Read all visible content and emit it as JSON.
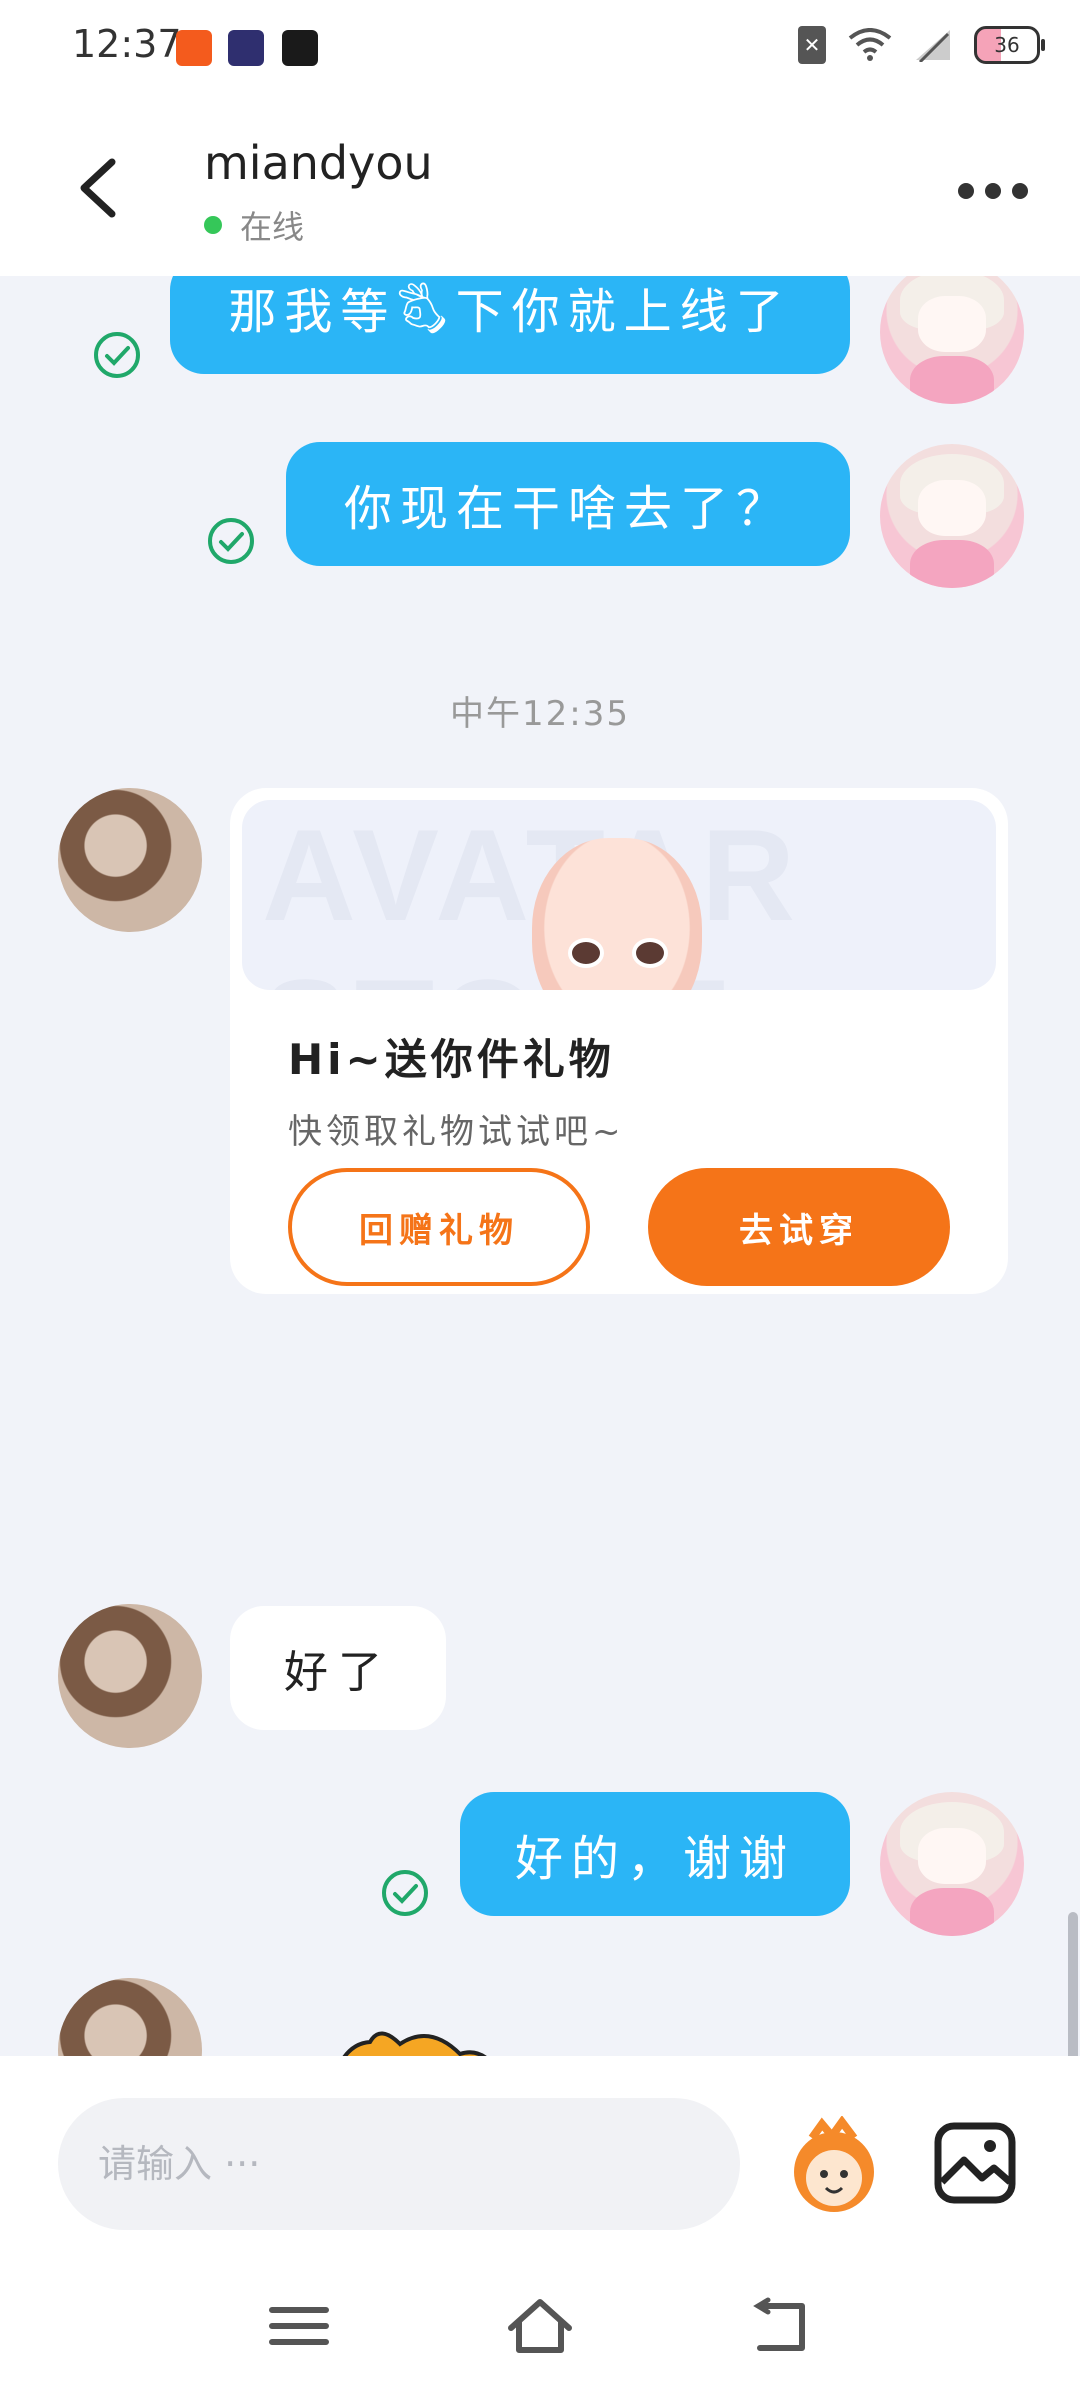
{
  "status_bar": {
    "time": "12:37",
    "battery": "36"
  },
  "header": {
    "contact_name": "miandyou",
    "status": "在线"
  },
  "messages": [
    {
      "side": "right",
      "type": "text",
      "text": "那我等🖏下你就上线了"
    },
    {
      "side": "right",
      "type": "text",
      "text": "你现在干啥去了？"
    },
    {
      "type": "timestamp",
      "text": "中午12:35"
    },
    {
      "side": "left",
      "type": "gift_card",
      "banner_watermark": "AVATAR STORE",
      "title": "Hi~送你件礼物",
      "subtitle": "快领取礼物试试吧~",
      "button_return": "回赠礼物",
      "button_try": "去试穿"
    },
    {
      "side": "left",
      "type": "text",
      "text": "好了"
    },
    {
      "side": "right",
      "type": "text",
      "text": "好的，谢谢"
    }
  ],
  "input": {
    "placeholder": "请输入 ···"
  },
  "colors": {
    "accent_blue": "#2bb5f6",
    "accent_orange": "#f57418",
    "online_green": "#35c759"
  },
  "icons": [
    "back-icon",
    "more-icon",
    "check-icon",
    "emoji-icon",
    "image-icon",
    "menu-icon",
    "home-icon",
    "back-nav-icon"
  ]
}
